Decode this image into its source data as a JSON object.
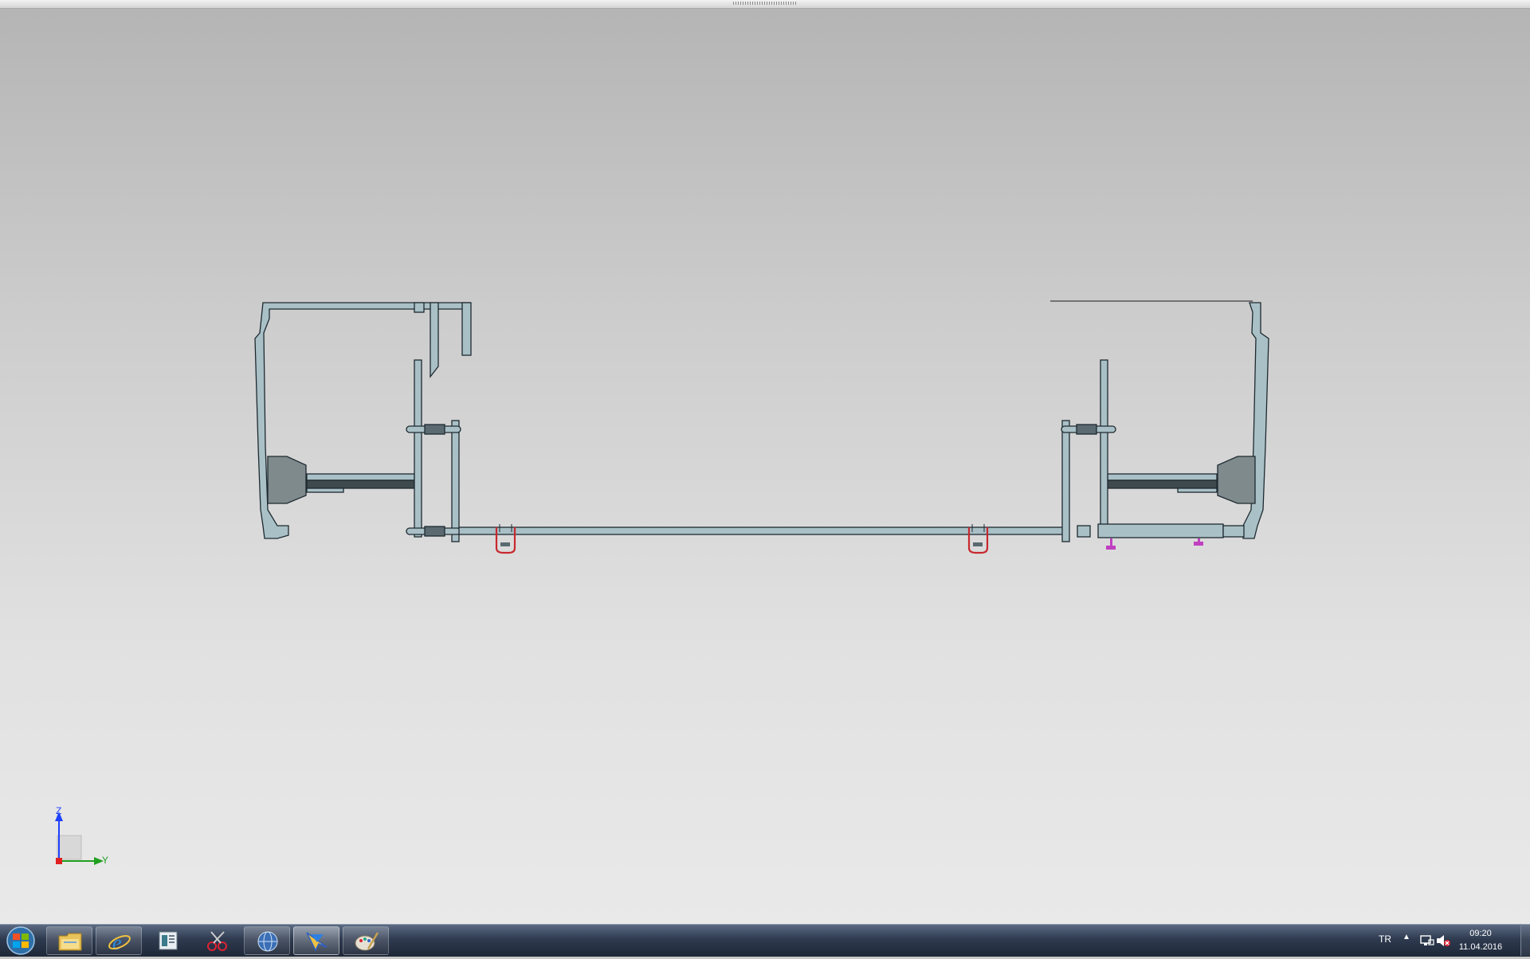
{
  "triad": {
    "z_label": "Z",
    "y_label": "Y"
  },
  "taskbar": {
    "start_label": "Start",
    "pinned": [
      {
        "name": "windows-explorer",
        "icon": "folder-icon",
        "state": "pinned"
      },
      {
        "name": "internet-explorer",
        "icon": "ie-icon",
        "state": "pinned"
      },
      {
        "name": "document-viewer",
        "icon": "document-icon",
        "state": "none"
      },
      {
        "name": "snipping-tool",
        "icon": "scissors-icon",
        "state": "none"
      },
      {
        "name": "browser-globe",
        "icon": "globe-icon",
        "state": "pinned"
      },
      {
        "name": "cad-application",
        "icon": "cad-app-icon",
        "state": "active"
      },
      {
        "name": "paint",
        "icon": "paint-icon",
        "state": "pinned"
      }
    ]
  },
  "tray": {
    "language": "TR",
    "time": "09:20",
    "date": "11.04.2016",
    "icons": [
      "show-hidden-icons-icon",
      "network-icon",
      "volume-muted-icon"
    ]
  },
  "colors": {
    "part_fill": "#a9c0c6",
    "part_stroke": "#1e2a30",
    "spring": "#5a6a70",
    "clip_red": "#c8282e",
    "magenta": "#c040c0",
    "axis_z": "#1e40ff",
    "axis_y": "#20a020",
    "origin": "#e02020"
  }
}
